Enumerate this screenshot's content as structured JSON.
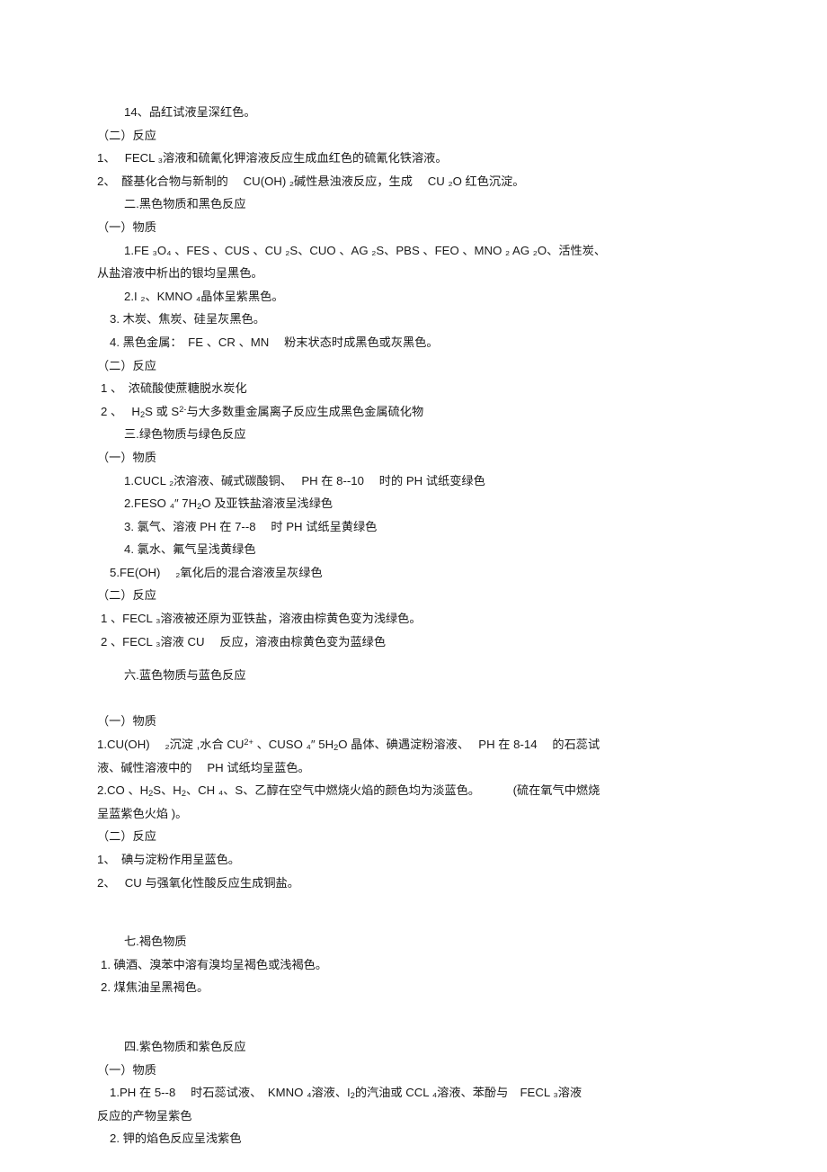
{
  "document": {
    "type": "study-notes",
    "language": "zh-CN",
    "subject": "化学颜色归纳",
    "lines": [
      {
        "id": "l01",
        "indent": 3,
        "text": "14、品红试液呈深红色。"
      },
      {
        "id": "l02",
        "indent": 0,
        "text": "（二）反应"
      },
      {
        "id": "l03",
        "indent": 0,
        "text": "1、　 FECL ₃溶液和硫氰化钾溶液反应生成血红色的硫氰化铁溶液。"
      },
      {
        "id": "l04",
        "indent": 0,
        "text": "2、　醛基化合物与新制的　 CU(OH) ₂碱性悬浊液反应，生成　 CU ₂O 红色沉淀。"
      },
      {
        "id": "l05",
        "indent": 3,
        "text": "二.黑色物质和黑色反应"
      },
      {
        "id": "l06",
        "indent": 0,
        "text": "（一）物质"
      },
      {
        "id": "l07",
        "indent": 3,
        "text": "1.FE ₃O₄ 、FES 、CUS 、CU ₂S、CUO 、AG ₂S、PBS 、FEO 、MNO ₂ AG ₂O、活性炭、"
      },
      {
        "id": "l08",
        "indent": 0,
        "text": "从盐溶液中析出的银均呈黑色。"
      },
      {
        "id": "l09",
        "indent": 3,
        "text": "2.I ₂、KMNO ₄晶体呈紫黑色。"
      },
      {
        "id": "l10",
        "indent": 2,
        "text": "3. 木炭、焦炭、硅呈灰黑色。"
      },
      {
        "id": "l11",
        "indent": 2,
        "text": "4. 黑色金属：　FE 、CR 、MN 　粉末状态时成黑色或灰黑色。"
      },
      {
        "id": "l12",
        "indent": 0,
        "text": "（二）反应"
      },
      {
        "id": "l13",
        "indent": 1,
        "text": "1 、　浓硫酸使蔗糖脱水炭化"
      },
      {
        "id": "l14",
        "indent": 1,
        "html": "2 、　 H<sub>2</sub>S 或 S<sup>2-</sup>与大多数重金属离子反应生成黑色金属硫化物"
      },
      {
        "id": "l15",
        "indent": 3,
        "text": "三.绿色物质与绿色反应"
      },
      {
        "id": "l16",
        "indent": 0,
        "text": "（一）物质"
      },
      {
        "id": "l17",
        "indent": 3,
        "text": "1.CUCL ₂浓溶液、碱式碳酸铜、　 PH 在 8--10 　时的 PH 试纸变绿色"
      },
      {
        "id": "l18",
        "indent": 3,
        "html": "2.FESO ₄″ 7H<sub>2</sub>O 及亚铁盐溶液呈浅绿色"
      },
      {
        "id": "l19",
        "indent": 3,
        "text": "3. 氯气、溶液 PH 在 7--8 　时 PH 试纸呈黄绿色"
      },
      {
        "id": "l20",
        "indent": 3,
        "text": "4. 氯水、氟气呈浅黄绿色"
      },
      {
        "id": "l21",
        "indent": 2,
        "text": "5.FE(OH) 　₂氧化后的混合溶液呈灰绿色"
      },
      {
        "id": "l22",
        "indent": 0,
        "text": "（二）反应"
      },
      {
        "id": "l23",
        "indent": 1,
        "text": "1 、FECL ₃溶液被还原为亚铁盐，溶液由棕黄色变为浅绿色。"
      },
      {
        "id": "l24",
        "indent": 1,
        "text": "2 、FECL ₃溶液 CU 　反应，溶液由棕黄色变为蓝绿色"
      },
      {
        "id": "l25",
        "indent": 3,
        "text": "六.蓝色物质与蓝色反应"
      },
      {
        "id": "l26",
        "indent": 0,
        "text": ""
      },
      {
        "id": "l27",
        "indent": 0,
        "text": "（一）物质"
      },
      {
        "id": "l28",
        "indent": 0,
        "html": "1.CU(OH) 　₂沉淀 ,水合 CU<sup>2+</sup> 、CUSO ₄″ 5H<sub>2</sub>O 晶体、碘遇淀粉溶液、　 PH 在 8-14 　的石蕊试"
      },
      {
        "id": "l29",
        "indent": 0,
        "text": "液、碱性溶液中的　 PH 试纸均呈蓝色。"
      },
      {
        "id": "l30",
        "indent": 0,
        "html": "2.CO 、H<sub>2</sub>S、H<sub>2</sub>、CH ₄、S、乙醇在空气中燃烧火焰的颜色均为淡蓝色。　　　 (硫在氧气中燃烧"
      },
      {
        "id": "l31",
        "indent": 0,
        "text": "呈蓝紫色火焰 )。"
      },
      {
        "id": "l32",
        "indent": 0,
        "text": "（二）反应"
      },
      {
        "id": "l33",
        "indent": 0,
        "text": "1、　碘与淀粉作用呈蓝色。"
      },
      {
        "id": "l34",
        "indent": 0,
        "text": "2、　 CU 与强氧化性酸反应生成铜盐。"
      },
      {
        "id": "l35",
        "indent": 3,
        "text": "七.褐色物质"
      },
      {
        "id": "l36",
        "indent": 1,
        "text": "1. 碘酒、溴苯中溶有溴均呈褐色或浅褐色。"
      },
      {
        "id": "l37",
        "indent": 1,
        "text": "2. 煤焦油呈黑褐色。"
      },
      {
        "id": "l38",
        "indent": 3,
        "text": "四.紫色物质和紫色反应"
      },
      {
        "id": "l39",
        "indent": 0,
        "text": "（一）物质"
      },
      {
        "id": "l40",
        "indent": 2,
        "html": "1.PH 在 5--8 　时石蕊试液、　KMNO ₄溶液、I<sub>2</sub>的汽油或 CCL ₄溶液、苯酚与　FECL ₃溶液"
      },
      {
        "id": "l41",
        "indent": 0,
        "text": "反应的产物呈紫色"
      },
      {
        "id": "l42",
        "indent": 2,
        "text": "2. 钾的焰色反应呈浅紫色"
      }
    ],
    "spacers": [
      {
        "after": "l24",
        "size": "gap-sm"
      },
      {
        "after": "l34",
        "size": "gap-lg"
      },
      {
        "after": "l37",
        "size": "gap-lg"
      }
    ]
  }
}
